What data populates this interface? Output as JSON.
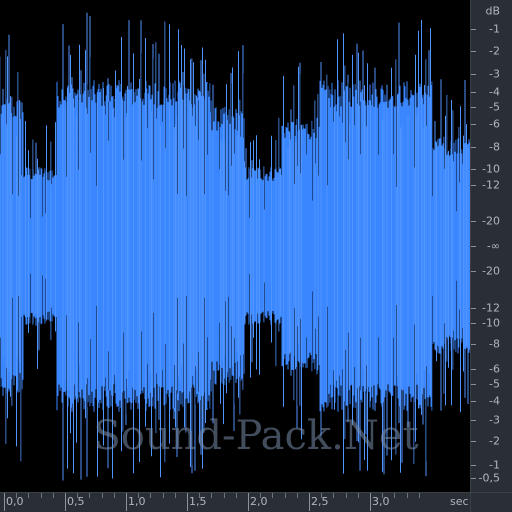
{
  "waveform": {
    "color": "#3a86ff",
    "background": "#000000",
    "channels": 1
  },
  "watermark": {
    "text": "Sound-Pack.Net"
  },
  "db_scale": {
    "unit": "dB",
    "labels": [
      "-1",
      "-2",
      "-3",
      "-4",
      "-5",
      "-6",
      "-8",
      "-10",
      "-12",
      "-20",
      "-∞",
      "-20",
      "-12",
      "-10",
      "-8",
      "-6",
      "-5",
      "-4",
      "-3",
      "-2",
      "-1",
      "-0,5"
    ]
  },
  "time_scale": {
    "unit": "sec",
    "labels": [
      "0,0",
      "0,5",
      "1,0",
      "1,5",
      "2,0",
      "2,5",
      "3,0"
    ]
  },
  "panels": {
    "ruler_color": "#2a2f35",
    "text_color": "#aeb6bf"
  }
}
